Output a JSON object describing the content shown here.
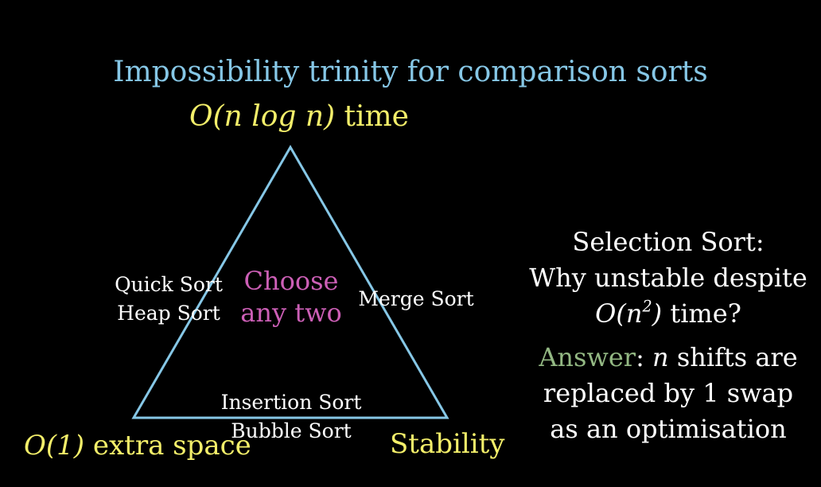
{
  "colors": {
    "background": "#000000",
    "title": "#86c7e6",
    "triangle": "#86c7e6",
    "corner": "#f4ef6a",
    "edge_text": "#ffffff",
    "center_text": "#cc5fb6",
    "panel_text": "#ffffff",
    "answer_label": "#93b883"
  },
  "title": "Impossibility trinity for comparison sorts",
  "corners": {
    "top": {
      "math": "O(n log n)",
      "text": "time"
    },
    "left": {
      "math": "O(1)",
      "text": "extra space"
    },
    "right": {
      "text": "Stability"
    }
  },
  "edges": {
    "left": [
      "Quick Sort",
      "Heap Sort"
    ],
    "right": [
      "Merge Sort"
    ],
    "bottom": [
      "Insertion Sort",
      "Bubble Sort"
    ]
  },
  "center": [
    "Choose",
    "any two"
  ],
  "side_panel": {
    "question_line1": "Selection Sort:",
    "question_line2": "Why unstable despite",
    "question_line3_math": "O(n²)",
    "question_line3_text": "time?",
    "answer_label": "Answer",
    "answer_line1_math": "n",
    "answer_line1_text": "shifts are",
    "answer_line2": "replaced by 1 swap",
    "answer_line3": "as an optimisation"
  }
}
